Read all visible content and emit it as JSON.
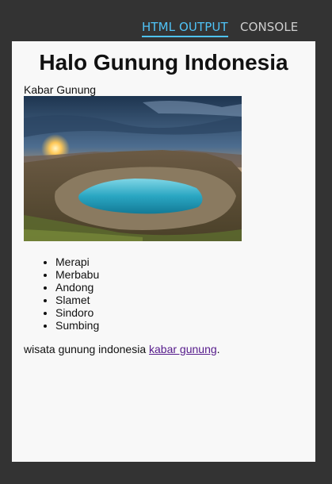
{
  "tabs": {
    "html_output": "HTML OUTPUT",
    "console": "CONSOLE"
  },
  "colors": {
    "background": "#333333",
    "active_tab": "#4fc3f7",
    "inactive_tab": "#cfcfcf",
    "output_panel": "#f8f8f8",
    "visited_link": "#551a8b"
  },
  "page": {
    "title": "Halo Gunung Indonesia",
    "caption": "Kabar Gunung",
    "image_icon": "mountain-crater-lake-photo",
    "mountains": [
      "Merapi",
      "Merbabu",
      "Andong",
      "Slamet",
      "Sindoro",
      "Sumbing"
    ],
    "footer_prefix": "wisata gunung indonesia ",
    "footer_link": "kabar gunung",
    "footer_suffix": "."
  }
}
